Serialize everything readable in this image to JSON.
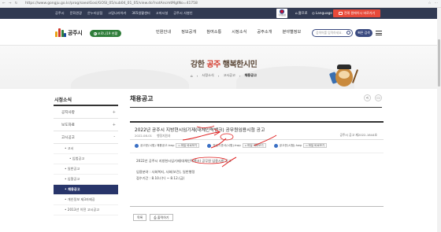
{
  "browser": {
    "url": "https://www.gongju.go.kr/prog/saeolGosi/GOSI_05/sub04_01_05/view.do?notAncmtMgtNo=41758",
    "back_icon": "back-icon",
    "forward_icon": "forward-icon",
    "refresh_icon": "refresh-icon"
  },
  "utility": {
    "links": [
      "공주시",
      "문화관광",
      "온누리상점",
      "고맙나라아카",
      "365생활센터",
      "고마시설",
      "공주시 사봉인"
    ],
    "emblem_label": "국가상징",
    "home_label": "홈으로",
    "language_label": "Language",
    "petition_label": "전례 원에이시 바로가기"
  },
  "header": {
    "logo_text": "공주시",
    "covid_label": "코로나19 현황",
    "menu": [
      "민원안내",
      "정보공개",
      "참여소통",
      "시정소식",
      "공주소개",
      "분야별정보"
    ],
    "search_placeholder": "검색어를 입력하세요.",
    "quick_label": "빠른 검색"
  },
  "banner": {
    "slogan_pre": "강한 ",
    "slogan_accent": "공주",
    "slogan_post": " 행복한시민",
    "breadcrumb": [
      "⌂",
      "시정소식",
      "고시공고",
      "채용공고"
    ]
  },
  "lnb": {
    "title": "시정소식",
    "items": [
      {
        "label": "공지사항"
      },
      {
        "label": "보도자료"
      },
      {
        "label": "고시공고"
      }
    ],
    "subs": [
      {
        "label": "• 고시"
      },
      {
        "label": "• 입법공고"
      },
      {
        "label": "• 일반공고"
      },
      {
        "label": "• 입찰공고"
      },
      {
        "label": "• 채용공고"
      },
      {
        "label": "• 개인정보 제3자제공"
      },
      {
        "label": "• 2013년 이전 고시공고"
      }
    ]
  },
  "content": {
    "page_title": "채용공고",
    "share_icon": "share-icon",
    "print_icon": "print-icon",
    "post": {
      "title": "2022년 공주시 지방현시임기제(대체인력뱅크) 공무원임용시험 공고",
      "date": "2022-08-01",
      "dept": "행정지원과",
      "doc_no": "공주시 공고 제2022-1644호",
      "files": [
        {
          "name": "공고문(시험) 채용공고.hwp",
          "btn": "파일 바로보기"
        },
        {
          "name": "작성기준서(시험).hwp",
          "btn": "파일 바로보기"
        },
        {
          "name": "공고문(시험).hwp",
          "btn": "파일 바로보기"
        }
      ],
      "body_line1": "2022년 공주시 지방현시임기제(대체인력뱅크) 공무원 임용시험 공고",
      "body_line2": "임용분야 : 사회복지, 사회(보건), 일반행정",
      "body_line3": "접수기간 : 8.10.(수) ~ 8.12.(금)"
    },
    "list_btn": "목록",
    "print_btn": "출력하기"
  },
  "colors": {
    "utility_bg": "#313a52",
    "petition_bg": "#e84a3a",
    "covid_bg": "#2f7d3a",
    "lnb_active_bg": "#28356a",
    "annotation_red": "#e02020"
  }
}
